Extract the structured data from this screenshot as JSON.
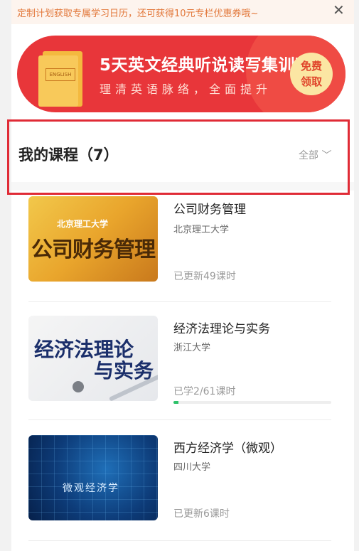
{
  "notice": {
    "text": "定制计划获取专属学习日历，还可获得10元专栏优惠券哦~",
    "close_icon": "close-icon"
  },
  "banner": {
    "title": "5天英文经典听说读写集训营",
    "subtitle": "理清英语脉络，全面提升",
    "book_label": "ENGLISH",
    "cta_line1": "免费",
    "cta_line2": "领取"
  },
  "my_courses": {
    "title": "我的课程（7）",
    "filter": "全部 ﹀"
  },
  "courses": [
    {
      "title": "公司财务管理",
      "school": "北京理工大学",
      "status": "已更新49课时",
      "thumb_school": "北京理工大学",
      "thumb_name": "公司财务管理"
    },
    {
      "title": "经济法理论与实务",
      "school": "浙江大学",
      "status": "已学2/61课时",
      "progress": 0.033,
      "thumb_name_1": "经济法理论",
      "thumb_name_2": "与实务"
    },
    {
      "title": "西方经济学（微观）",
      "school": "四川大学",
      "status": "已更新6课时",
      "thumb_name": "微观经济学"
    }
  ],
  "colors": {
    "banner_red": "#e8363a",
    "notice_orange": "#e2773a",
    "highlight_red": "#e02b36",
    "progress_green": "#2ec26a"
  }
}
